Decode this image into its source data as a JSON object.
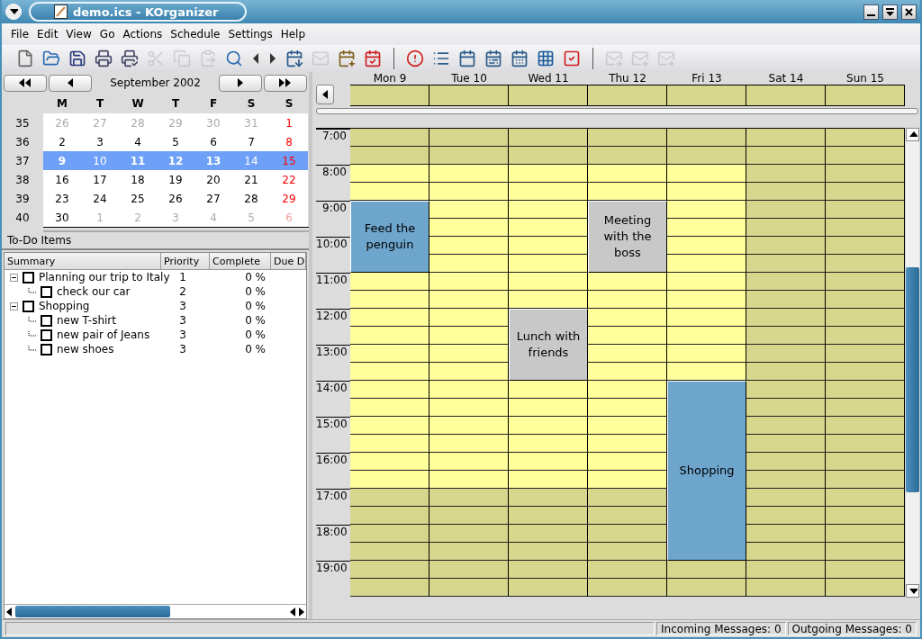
{
  "window": {
    "title": "demo.ics - KOrganizer"
  },
  "menu": [
    "File",
    "Edit",
    "View",
    "Go",
    "Actions",
    "Schedule",
    "Settings",
    "Help"
  ],
  "toolbar": [
    {
      "kind": "new",
      "disabled": false
    },
    {
      "kind": "open",
      "disabled": false
    },
    {
      "kind": "save",
      "disabled": false
    },
    {
      "kind": "print",
      "disabled": false
    },
    {
      "kind": "print-preview",
      "disabled": false
    },
    {
      "kind": "cut",
      "disabled": true
    },
    {
      "kind": "copy",
      "disabled": true
    },
    {
      "kind": "paste",
      "disabled": true
    },
    {
      "kind": "find",
      "disabled": false
    },
    {
      "kind": "back",
      "disabled": false
    },
    {
      "kind": "forward",
      "disabled": false
    },
    {
      "kind": "import",
      "disabled": false
    },
    {
      "kind": "mail",
      "disabled": true
    },
    {
      "kind": "new-event",
      "disabled": false
    },
    {
      "kind": "new-todo",
      "disabled": false
    },
    {
      "kind": "separator"
    },
    {
      "kind": "whats-next",
      "disabled": false
    },
    {
      "kind": "list",
      "disabled": false
    },
    {
      "kind": "day",
      "disabled": false
    },
    {
      "kind": "work-week",
      "disabled": false
    },
    {
      "kind": "week",
      "disabled": false
    },
    {
      "kind": "month",
      "disabled": false
    },
    {
      "kind": "todo",
      "disabled": false
    },
    {
      "kind": "separator"
    },
    {
      "kind": "send",
      "disabled": true
    },
    {
      "kind": "send",
      "disabled": true
    },
    {
      "kind": "send",
      "disabled": true
    }
  ],
  "mini_calendar": {
    "month_label": "September 2002",
    "weekdays": [
      "M",
      "T",
      "W",
      "T",
      "F",
      "S",
      "S"
    ],
    "weeks": [
      {
        "number": "35",
        "selected": false,
        "days": [
          {
            "label": "26",
            "other_month": true,
            "holiday": false,
            "has_events": false
          },
          {
            "label": "27",
            "other_month": true,
            "holiday": false,
            "has_events": false
          },
          {
            "label": "28",
            "other_month": true,
            "holiday": false,
            "has_events": false
          },
          {
            "label": "29",
            "other_month": true,
            "holiday": false,
            "has_events": false
          },
          {
            "label": "30",
            "other_month": true,
            "holiday": false,
            "has_events": false
          },
          {
            "label": "31",
            "other_month": true,
            "holiday": false,
            "has_events": false
          },
          {
            "label": "1",
            "other_month": false,
            "holiday": true,
            "has_events": false
          }
        ]
      },
      {
        "number": "36",
        "selected": false,
        "days": [
          {
            "label": "2",
            "other_month": false,
            "holiday": false,
            "has_events": false
          },
          {
            "label": "3",
            "other_month": false,
            "holiday": false,
            "has_events": false
          },
          {
            "label": "4",
            "other_month": false,
            "holiday": false,
            "has_events": false
          },
          {
            "label": "5",
            "other_month": false,
            "holiday": false,
            "has_events": false
          },
          {
            "label": "6",
            "other_month": false,
            "holiday": false,
            "has_events": false
          },
          {
            "label": "7",
            "other_month": false,
            "holiday": false,
            "has_events": false
          },
          {
            "label": "8",
            "other_month": false,
            "holiday": true,
            "has_events": false
          }
        ]
      },
      {
        "number": "37",
        "selected": true,
        "days": [
          {
            "label": "9",
            "other_month": false,
            "holiday": false,
            "has_events": true
          },
          {
            "label": "10",
            "other_month": false,
            "holiday": false,
            "has_events": false
          },
          {
            "label": "11",
            "other_month": false,
            "holiday": false,
            "has_events": true
          },
          {
            "label": "12",
            "other_month": false,
            "holiday": false,
            "has_events": true
          },
          {
            "label": "13",
            "other_month": false,
            "holiday": false,
            "has_events": true
          },
          {
            "label": "14",
            "other_month": false,
            "holiday": false,
            "has_events": false
          },
          {
            "label": "15",
            "other_month": false,
            "holiday": true,
            "has_events": false
          }
        ]
      },
      {
        "number": "38",
        "selected": false,
        "days": [
          {
            "label": "16",
            "other_month": false,
            "holiday": false,
            "has_events": false
          },
          {
            "label": "17",
            "other_month": false,
            "holiday": false,
            "has_events": false
          },
          {
            "label": "18",
            "other_month": false,
            "holiday": false,
            "has_events": false
          },
          {
            "label": "19",
            "other_month": false,
            "holiday": false,
            "has_events": false
          },
          {
            "label": "20",
            "other_month": false,
            "holiday": false,
            "has_events": false
          },
          {
            "label": "21",
            "other_month": false,
            "holiday": false,
            "has_events": false
          },
          {
            "label": "22",
            "other_month": false,
            "holiday": true,
            "has_events": false
          }
        ]
      },
      {
        "number": "39",
        "selected": false,
        "days": [
          {
            "label": "23",
            "other_month": false,
            "holiday": false,
            "has_events": false
          },
          {
            "label": "24",
            "other_month": false,
            "holiday": false,
            "has_events": false
          },
          {
            "label": "25",
            "other_month": false,
            "holiday": false,
            "has_events": false
          },
          {
            "label": "26",
            "other_month": false,
            "holiday": false,
            "has_events": false
          },
          {
            "label": "27",
            "other_month": false,
            "holiday": false,
            "has_events": false
          },
          {
            "label": "28",
            "other_month": false,
            "holiday": false,
            "has_events": false
          },
          {
            "label": "29",
            "other_month": false,
            "holiday": true,
            "has_events": false
          }
        ]
      },
      {
        "number": "40",
        "selected": false,
        "days": [
          {
            "label": "30",
            "other_month": false,
            "holiday": false,
            "has_events": false
          },
          {
            "label": "1",
            "other_month": true,
            "holiday": false,
            "has_events": false
          },
          {
            "label": "2",
            "other_month": true,
            "holiday": false,
            "has_events": false
          },
          {
            "label": "3",
            "other_month": true,
            "holiday": false,
            "has_events": false
          },
          {
            "label": "4",
            "other_month": true,
            "holiday": false,
            "has_events": false
          },
          {
            "label": "5",
            "other_month": true,
            "holiday": false,
            "has_events": false
          },
          {
            "label": "6",
            "other_month": true,
            "holiday": true,
            "has_events": false
          }
        ]
      }
    ]
  },
  "todo": {
    "title": "To-Do Items",
    "columns": [
      "Summary",
      "Priority",
      "Complete",
      "Due D"
    ],
    "items": [
      {
        "summary": "Planning our trip to Italy",
        "priority": "1",
        "complete": "0 %",
        "checked": false,
        "expanded": true,
        "children": [
          {
            "summary": "check our car",
            "priority": "2",
            "complete": "0 %",
            "checked": false
          }
        ]
      },
      {
        "summary": "Shopping",
        "priority": "3",
        "complete": "0 %",
        "checked": false,
        "expanded": true,
        "children": [
          {
            "summary": "new T-shirt",
            "priority": "3",
            "complete": "0 %",
            "checked": false
          },
          {
            "summary": "new pair of Jeans",
            "priority": "3",
            "complete": "0 %",
            "checked": false
          },
          {
            "summary": "new shoes",
            "priority": "3",
            "complete": "0 %",
            "checked": false
          }
        ]
      }
    ]
  },
  "agenda": {
    "hours": [
      "7:00",
      "8:00",
      "9:00",
      "10:00",
      "11:00",
      "12:00",
      "13:00",
      "14:00",
      "15:00",
      "16:00",
      "17:00",
      "18:00",
      "19:00"
    ],
    "days": [
      {
        "label": "Mon 9",
        "slots": [
          {
            "kind": "off"
          },
          {
            "kind": "work"
          },
          {
            "kind": "event",
            "title": "Feed the penguin",
            "color": "#6ea5cd"
          },
          {
            "kind": "continued"
          },
          {
            "kind": "work"
          },
          {
            "kind": "work"
          },
          {
            "kind": "work"
          },
          {
            "kind": "work"
          },
          {
            "kind": "work"
          },
          {
            "kind": "work"
          },
          {
            "kind": "off"
          },
          {
            "kind": "off"
          },
          {
            "kind": "off"
          }
        ]
      },
      {
        "label": "Tue 10",
        "slots": [
          {
            "kind": "off"
          },
          {
            "kind": "work"
          },
          {
            "kind": "work"
          },
          {
            "kind": "work"
          },
          {
            "kind": "work"
          },
          {
            "kind": "work"
          },
          {
            "kind": "work"
          },
          {
            "kind": "work"
          },
          {
            "kind": "work"
          },
          {
            "kind": "work"
          },
          {
            "kind": "off"
          },
          {
            "kind": "off"
          },
          {
            "kind": "off"
          }
        ]
      },
      {
        "label": "Wed 11",
        "slots": [
          {
            "kind": "off"
          },
          {
            "kind": "work"
          },
          {
            "kind": "work"
          },
          {
            "kind": "work"
          },
          {
            "kind": "work"
          },
          {
            "kind": "event",
            "title": "Lunch with friends",
            "color": "#c8c8c8"
          },
          {
            "kind": "continued"
          },
          {
            "kind": "work"
          },
          {
            "kind": "work"
          },
          {
            "kind": "work"
          },
          {
            "kind": "off"
          },
          {
            "kind": "off"
          },
          {
            "kind": "off"
          }
        ]
      },
      {
        "label": "Thu 12",
        "slots": [
          {
            "kind": "off"
          },
          {
            "kind": "work"
          },
          {
            "kind": "event",
            "title": "Meeting with the boss",
            "color": "#c8c8c8"
          },
          {
            "kind": "continued"
          },
          {
            "kind": "work"
          },
          {
            "kind": "work"
          },
          {
            "kind": "work"
          },
          {
            "kind": "work"
          },
          {
            "kind": "work"
          },
          {
            "kind": "work"
          },
          {
            "kind": "off"
          },
          {
            "kind": "off"
          },
          {
            "kind": "off"
          }
        ]
      },
      {
        "label": "Fri 13",
        "slots": [
          {
            "kind": "off"
          },
          {
            "kind": "work"
          },
          {
            "kind": "work"
          },
          {
            "kind": "work"
          },
          {
            "kind": "work"
          },
          {
            "kind": "work"
          },
          {
            "kind": "work"
          },
          {
            "kind": "event",
            "title": "Shopping",
            "color": "#6ea5cd"
          },
          {
            "kind": "continued"
          },
          {
            "kind": "continued"
          },
          {
            "kind": "continued"
          },
          {
            "kind": "continued"
          },
          {
            "kind": "off"
          }
        ]
      },
      {
        "label": "Sat 14",
        "slots": [
          {
            "kind": "off"
          },
          {
            "kind": "off"
          },
          {
            "kind": "off"
          },
          {
            "kind": "off"
          },
          {
            "kind": "off"
          },
          {
            "kind": "off"
          },
          {
            "kind": "off"
          },
          {
            "kind": "off"
          },
          {
            "kind": "off"
          },
          {
            "kind": "off"
          },
          {
            "kind": "off"
          },
          {
            "kind": "off"
          },
          {
            "kind": "off"
          }
        ]
      },
      {
        "label": "Sun 15",
        "slots": [
          {
            "kind": "off"
          },
          {
            "kind": "off"
          },
          {
            "kind": "off"
          },
          {
            "kind": "off"
          },
          {
            "kind": "off"
          },
          {
            "kind": "off"
          },
          {
            "kind": "off"
          },
          {
            "kind": "off"
          },
          {
            "kind": "off"
          },
          {
            "kind": "off"
          },
          {
            "kind": "off"
          },
          {
            "kind": "off"
          },
          {
            "kind": "off"
          }
        ]
      }
    ]
  },
  "status_bar": [
    "Incoming Messages: 0",
    "Outgoing Messages: 0"
  ]
}
